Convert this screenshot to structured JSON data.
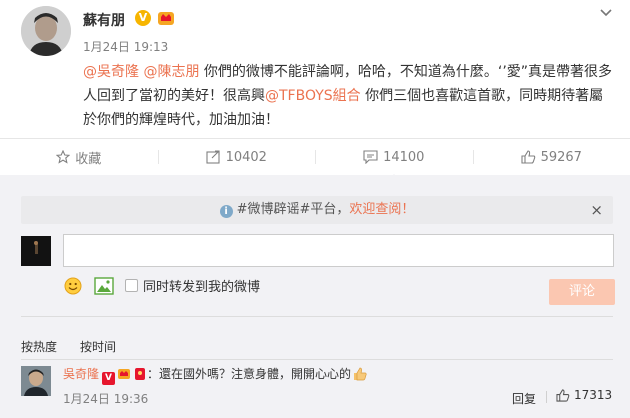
{
  "post": {
    "author": "蘇有朋",
    "time": "1月24日 19:13",
    "text_parts": {
      "mention1": "@吳奇隆",
      "mention2": "@陳志朋",
      "seg1": " 你們的微博不能評論啊，哈哈，不知道為什麼。‘’愛”真是帶著很多人回到了當初的美好！很高興",
      "mention3": "@TFBOYS組合",
      "seg2": " 你們三個也喜歡這首歌，同時期待著屬於你們的輝煌時代，加油加油！"
    }
  },
  "actions": {
    "favorite_label": "收藏",
    "repost_count": "10402",
    "comment_count": "14100",
    "like_count": "59267"
  },
  "comment_panel": {
    "notice_prefix": "#微博辟谣#平台，",
    "notice_link": "欢迎查阅！",
    "notice_close": "×",
    "input_value": "",
    "repost_checkbox_label": "同时转发到我的微博",
    "submit_label": "评论",
    "sort_hot": "按热度",
    "sort_time": "按时间"
  },
  "comment": {
    "author": "吳奇隆",
    "text": "：還在國外嗎？注意身體，開開心心的",
    "time": "1月24日 19:36",
    "reply_label": "回复",
    "like_count": "17313"
  },
  "colors": {
    "accent": "#eb7350",
    "link_blue": "#eb7350",
    "submit_disabled": "#fbc7b1",
    "panel_bg": "#f2f2f5"
  },
  "icons": {
    "post_menu": "chevron-down-icon",
    "favorite": "star-icon",
    "repost": "repost-icon",
    "comment": "comment-icon",
    "like": "thumbs-up-icon",
    "emoji": "smiley-icon",
    "image": "picture-icon"
  }
}
